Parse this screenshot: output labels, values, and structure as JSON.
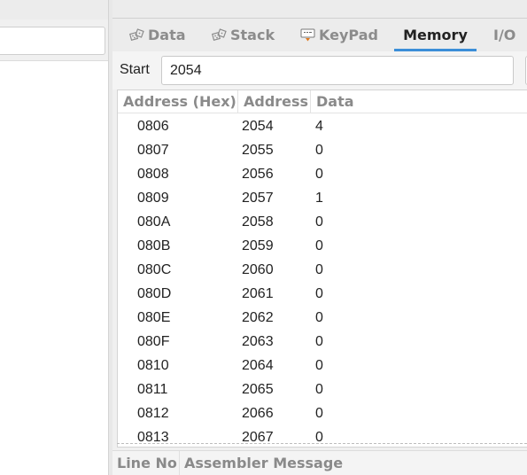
{
  "tabs": [
    {
      "label": "Data",
      "icon": "dice-icon",
      "active": false
    },
    {
      "label": "Stack",
      "icon": "dice-icon",
      "active": false
    },
    {
      "label": "KeyPad",
      "icon": "keypad-icon",
      "active": false
    },
    {
      "label": "Memory",
      "icon": "",
      "active": true
    },
    {
      "label": "I/O",
      "icon": "",
      "active": false
    }
  ],
  "start": {
    "label": "Start",
    "value": "2054"
  },
  "memory_table": {
    "headers": [
      "Address (Hex)",
      "Address",
      "Data"
    ],
    "rows": [
      [
        "0806",
        "2054",
        "4"
      ],
      [
        "0807",
        "2055",
        "0"
      ],
      [
        "0808",
        "2056",
        "0"
      ],
      [
        "0809",
        "2057",
        "1"
      ],
      [
        "080A",
        "2058",
        "0"
      ],
      [
        "080B",
        "2059",
        "0"
      ],
      [
        "080C",
        "2060",
        "0"
      ],
      [
        "080D",
        "2061",
        "0"
      ],
      [
        "080E",
        "2062",
        "0"
      ],
      [
        "080F",
        "2063",
        "0"
      ],
      [
        "0810",
        "2064",
        "0"
      ],
      [
        "0811",
        "2065",
        "0"
      ],
      [
        "0812",
        "2066",
        "0"
      ],
      [
        "0813",
        "2067",
        "0"
      ]
    ]
  },
  "messages": {
    "headers": [
      "Line No",
      "Assembler Message"
    ]
  },
  "colors": {
    "accent": "#3b8ed8",
    "tab_inactive": "#8c8c8c",
    "tab_active": "#222222"
  }
}
